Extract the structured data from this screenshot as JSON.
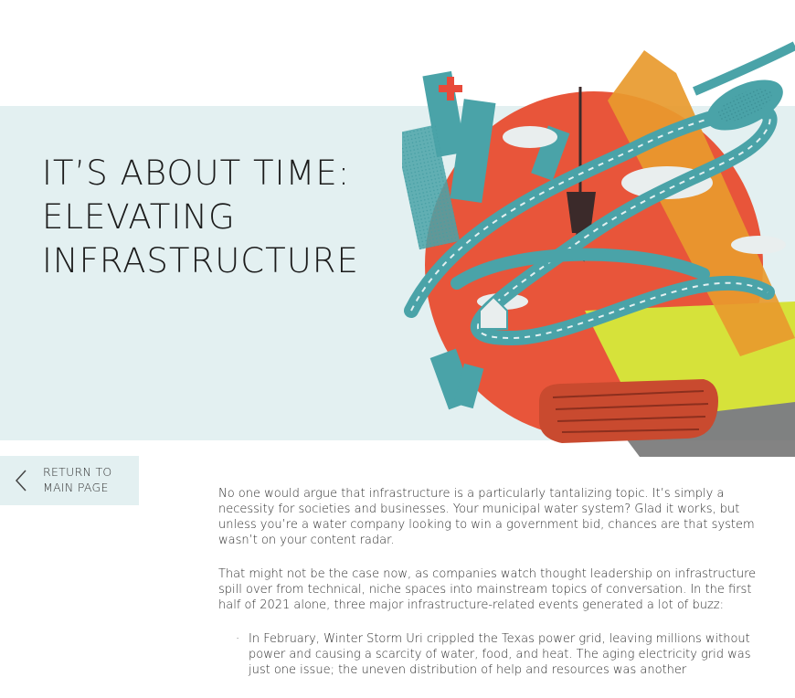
{
  "hero": {
    "title_lines": [
      "IT’S ABOUT TIME:",
      "ELEVATING",
      "INFRASTRUCTURE"
    ]
  },
  "nav": {
    "return_lines": [
      "RETURN TO",
      "MAIN PAGE"
    ],
    "icon": "chevron-left-icon"
  },
  "article": {
    "paragraphs": [
      "No one would argue that infrastructure is a particularly tantalizing topic. It’s simply a necessity for societies and businesses. Your municipal water system? Glad it works, but unless you’re a water company looking to win a government bid, chances are that system wasn’t on your content radar.",
      "That might not be the case now, as companies watch thought leadership on infrastructure spill over from technical, niche spaces into mainstream topics of conversation. In the first half of 2021 alone, three major infrastructure-related events generated a lot of buzz:"
    ],
    "bullets": [
      "In February, Winter Storm Uri crippled the Texas power grid, leaving millions without power and causing a scarcity of water, food, and heat. The aging electricity grid was just one issue; the uneven distribution of help and resources was another"
    ]
  },
  "colors": {
    "band": "#e3f0f1",
    "teal": "#4aa3a8",
    "orange": "#e8553a",
    "amber": "#e89a2e",
    "lime": "#d6e23a"
  }
}
